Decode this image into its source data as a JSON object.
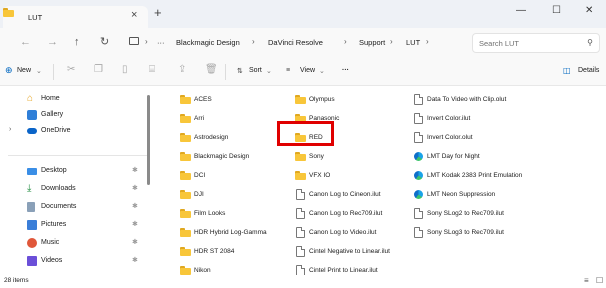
{
  "window": {
    "tab_title": "LUT",
    "tab_close": "×",
    "new_tab": "+",
    "minimize": "—",
    "maximize": "☐",
    "close": "✕"
  },
  "nav": {
    "back": "←",
    "forward": "→",
    "up": "↑",
    "refresh": "↻",
    "more": "···",
    "breadcrumbs": [
      "Blackmagic Design",
      "DaVinci Resolve",
      "Support",
      "LUT"
    ],
    "search_placeholder": "Search LUT"
  },
  "command_bar": {
    "new_label": "New",
    "sort_label": "Sort",
    "view_label": "View",
    "more": "···",
    "details_label": "Details"
  },
  "sidebar": {
    "items": [
      {
        "label": "Home",
        "icon": "home-icon"
      },
      {
        "label": "Gallery",
        "icon": "gallery-icon"
      },
      {
        "label": "OneDrive",
        "icon": "cloud-icon"
      },
      {
        "label": "Desktop",
        "icon": "desktop-icon"
      },
      {
        "label": "Downloads",
        "icon": "download-icon"
      },
      {
        "label": "Documents",
        "icon": "documents-icon"
      },
      {
        "label": "Pictures",
        "icon": "pictures-icon"
      },
      {
        "label": "Music",
        "icon": "music-icon"
      },
      {
        "label": "Videos",
        "icon": "videos-icon"
      }
    ]
  },
  "files": {
    "column1": [
      "ACES",
      "Arri",
      "Astrodesign",
      "Blackmagic Design",
      "DCI",
      "DJI",
      "Film Looks",
      "HDR Hybrid Log-Gamma",
      "HDR ST 2084",
      "Nikon"
    ],
    "column2_folders": [
      "Olympus",
      "Panasonic",
      "RED",
      "Sony",
      "VFX IO"
    ],
    "column2_files": [
      "Canon Log to Cineon.ilut",
      "Canon Log to Rec709.ilut",
      "Canon Log to Video.ilut",
      "Cintel Negative to Linear.ilut",
      "Cintel Print to Linear.ilut"
    ],
    "column3_files": [
      "Data To Video with Clip.olut",
      "Invert Color.ilut",
      "Invert Color.olut"
    ],
    "column3_lmt": [
      "LMT Day for Night",
      "LMT Kodak 2383 Print Emulation",
      "LMT Neon Suppression"
    ],
    "column3_more": [
      "Sony SLog2 to Rec709.ilut",
      "Sony SLog3 to Rec709.ilut"
    ]
  },
  "status": {
    "item_count": "28 items"
  },
  "colors": {
    "highlight": "#e00000",
    "folder": "#f8c63a"
  }
}
